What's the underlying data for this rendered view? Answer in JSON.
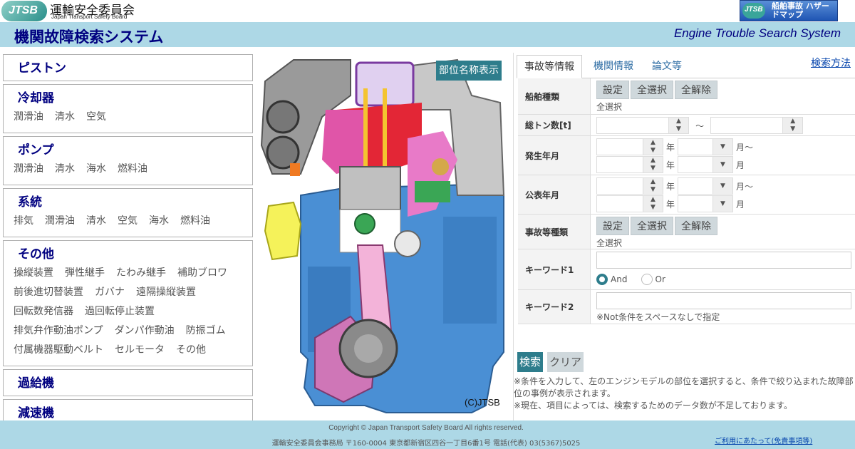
{
  "header": {
    "logo_abbr": "JTSB",
    "logo_name": "運輸安全委員会",
    "logo_en": "Japan Transport Safety Board",
    "hazard_abbr": "JTSB",
    "hazard_label": "船舶事故 ハザードマップ"
  },
  "title": {
    "ja": "機関故障検索システム",
    "en": "Engine Trouble Search System"
  },
  "categories": [
    {
      "title": "ピストン",
      "rows": []
    },
    {
      "title": "冷却器",
      "rows": [
        [
          "潤滑油",
          "清水",
          "空気"
        ]
      ]
    },
    {
      "title": "ポンプ",
      "rows": [
        [
          "潤滑油",
          "清水",
          "海水",
          "燃料油"
        ]
      ]
    },
    {
      "title": "系統",
      "rows": [
        [
          "排気",
          "潤滑油",
          "清水",
          "空気",
          "海水",
          "燃料油"
        ]
      ]
    },
    {
      "title": "その他",
      "rows": [
        [
          "操縦装置",
          "弾性継手",
          "たわみ継手",
          "補助ブロワ"
        ],
        [
          "前後進切替装置",
          "ガバナ",
          "遠隔操縦装置"
        ],
        [
          "回転数発信器",
          "過回転停止装置"
        ],
        [
          "排気弁作動油ポンプ",
          "ダンパ作動油",
          "防振ゴム"
        ],
        [
          "付属機器駆動ベルト",
          "セルモータ",
          "その他"
        ]
      ]
    },
    {
      "title": "過給機",
      "rows": []
    },
    {
      "title": "減速機",
      "rows": []
    }
  ],
  "engine": {
    "parts_toggle": "部位名称表示",
    "copyright": "(C)JTSB"
  },
  "tabs": [
    "事故等情報",
    "機関情報",
    "論文等"
  ],
  "howto": "検索方法",
  "form": {
    "ship_type": {
      "label": "船舶種類",
      "buttons": [
        "設定",
        "全選択",
        "全解除"
      ],
      "status": "全選択"
    },
    "tonnage": {
      "label": "総トン数[t]",
      "sep": "～"
    },
    "occurred": {
      "label": "発生年月",
      "year": "年",
      "month_from": "月～",
      "month": "月"
    },
    "published": {
      "label": "公表年月",
      "year": "年",
      "month_from": "月～",
      "month": "月"
    },
    "accident_type": {
      "label": "事故等種類",
      "buttons": [
        "設定",
        "全選択",
        "全解除"
      ],
      "status": "全選択"
    },
    "keyword1": {
      "label": "キーワード1",
      "value": "",
      "options": [
        "And",
        "Or"
      ],
      "selected": "And"
    },
    "keyword2": {
      "label": "キーワード2",
      "value": "",
      "note": "※Not条件をスペースなしで指定"
    }
  },
  "actions": {
    "search": "検索",
    "clear": "クリア"
  },
  "notes": [
    "※条件を入力して、左のエンジンモデルの部位を選択すると、条件で絞り込まれた故障部位の事例が表示されます。",
    "※現在、項目によっては、検索するためのデータ数が不足しております。"
  ],
  "footer": {
    "copyright": "Copyright © Japan Transport Safety Board All rights reserved.",
    "address": "運輸安全委員会事務局 〒160-0004 東京都新宿区四谷一丁目6番1号 電話(代表) 03(5367)5025",
    "disclaimer": "ご利用にあたって(免責事項等)"
  },
  "colors": {
    "accent": "#2e7d8c",
    "band": "#add8e6",
    "title": "#000080"
  }
}
